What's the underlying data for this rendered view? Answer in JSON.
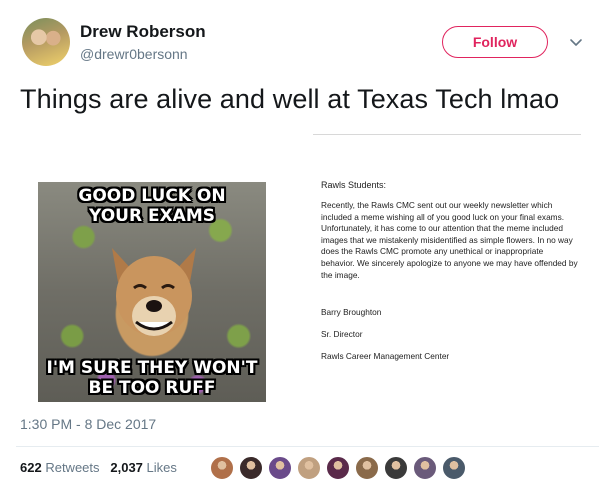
{
  "author": {
    "display_name": "Drew Roberson",
    "handle": "@drewr0bersonn",
    "follow_label": "Follow"
  },
  "tweet": {
    "text": "Things are alive and well at Texas Tech lmao",
    "timestamp": "1:30 PM - 8 Dec 2017"
  },
  "meme": {
    "top_text": "GOOD LUCK ON YOUR EXAMS",
    "bottom_text": "I'M SURE THEY WON'T BE TOO RUFF"
  },
  "letter": {
    "salutation": "Rawls Students:",
    "body": "Recently, the Rawls CMC sent out our weekly newsletter which included a meme wishing all of you good luck on your final exams. Unfortunately, it has come to our attention that the meme included images that we mistakenly misidentified as simple flowers. In no way does the Rawls CMC promote any unethical or inappropriate behavior. We sincerely apologize to anyone we may have offended by the image.",
    "signer": "Barry Broughton",
    "signer_title": "Sr. Director",
    "signer_org": "Rawls Career Management Center"
  },
  "stats": {
    "retweets_count": "622",
    "retweets_label": "Retweets",
    "likes_count": "2,037",
    "likes_label": "Likes"
  },
  "likers": [
    "#b0704a",
    "#3a2a2a",
    "#6a4a8a",
    "#c0a080",
    "#5a2a4a",
    "#8a6a4a",
    "#3a3a3a",
    "#6a5a7a",
    "#4a5a6a"
  ],
  "colors": {
    "follow_accent": "#e0245e",
    "muted_text": "#657786"
  }
}
